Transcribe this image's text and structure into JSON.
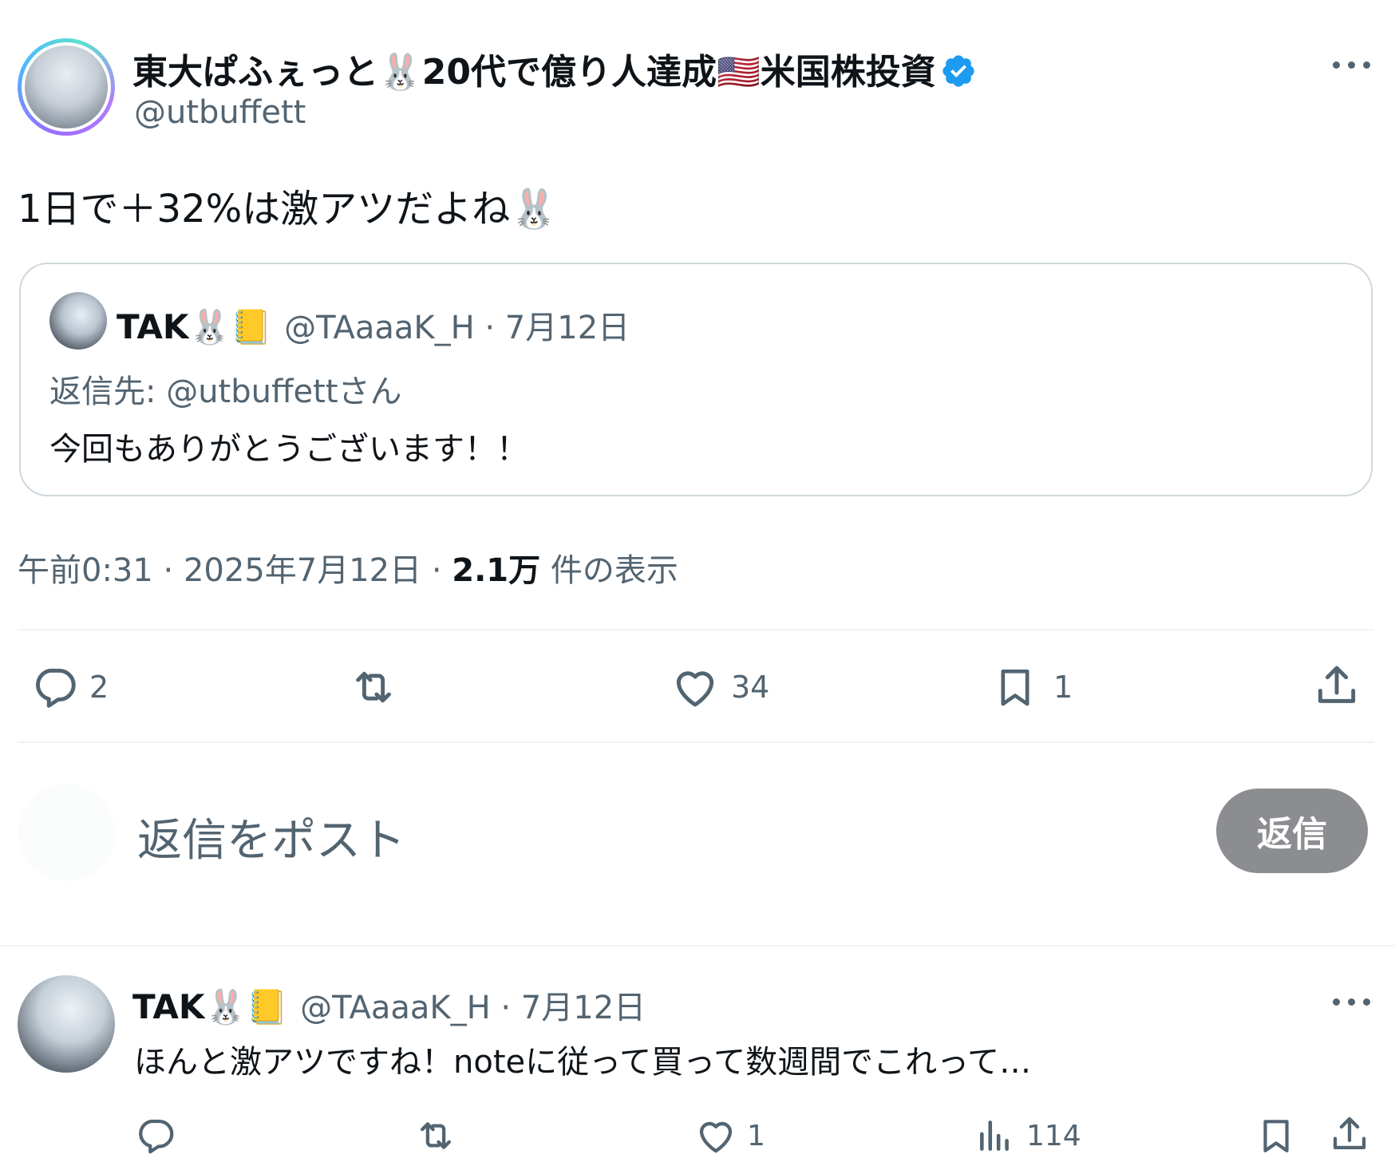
{
  "main_post": {
    "display_name": "東大ぱふぇっと🐰20代で億り人達成🇺🇸米国株投資",
    "handle": "@utbuffett",
    "text": "1日で＋32%は激アツだよね🐰",
    "timestamp": "午前0:31 · 2025年7月12日 · ",
    "views_count": "2.1万",
    "views_label": " 件の表示",
    "more_icon": "more-icon",
    "verified_color": "#1d9bf0"
  },
  "quote": {
    "display_name": "TAK🐰📒",
    "handle_date": "@TAaaaK_H · 7月12日",
    "reply_to": "返信先: @utbuffettさん",
    "text": "今回もありがとうございます！！"
  },
  "actions": {
    "reply_count": "2",
    "repost_count": "",
    "like_count": "34",
    "bookmark_count": "1"
  },
  "composer": {
    "placeholder": "返信をポスト",
    "button_label": "返信"
  },
  "reply": {
    "display_name": "TAK🐰📒",
    "handle_date": "@TAaaaK_H · 7月12日",
    "text": "ほんと激アツですね！noteに従って買って数週間でこれって…",
    "like_count": "1",
    "views_count": "114"
  }
}
